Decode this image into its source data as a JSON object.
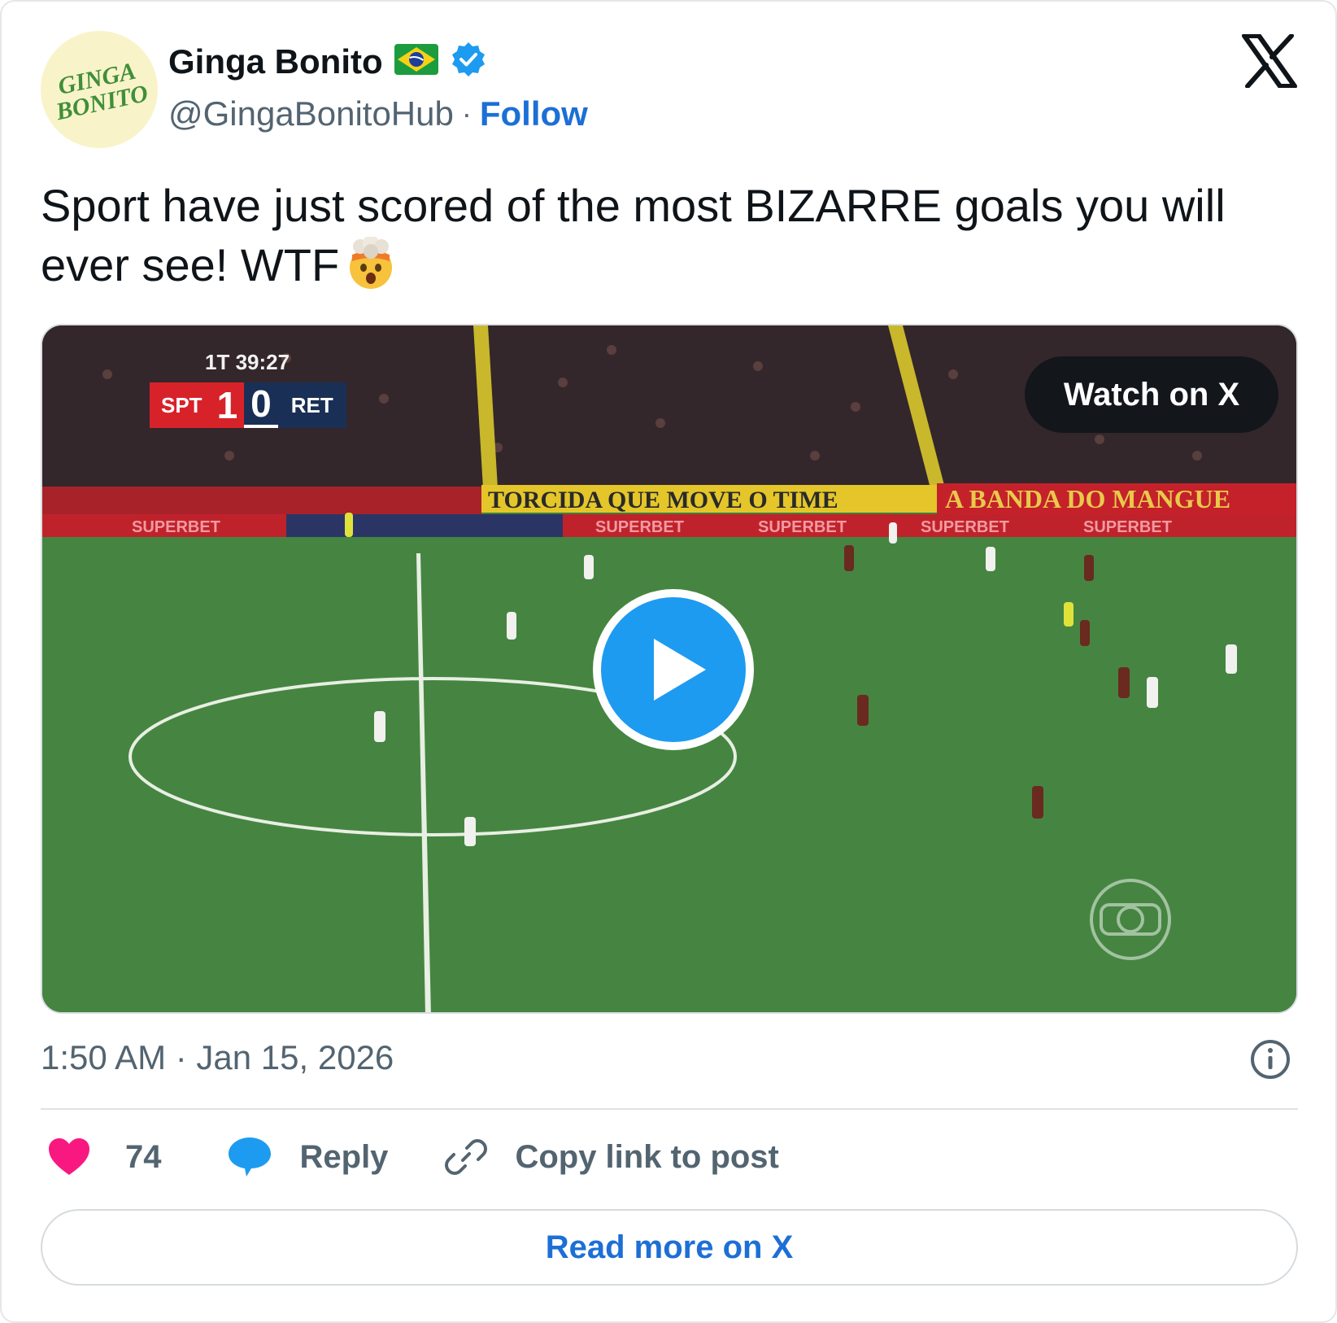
{
  "author": {
    "name": "Ginga Bonito",
    "handle": "@GingaBonitoHub",
    "separator": "·",
    "follow_label": "Follow",
    "avatar_text_line1": "GINGA",
    "avatar_text_line2": "BONITO",
    "avatar_icon": "ginga-bonito-logo",
    "flag_icon": "brazil-flag-icon",
    "verified_icon": "verified-badge-icon"
  },
  "platform_icon": "x-logo-icon",
  "tweet": {
    "text": "Sport have just scored of the most BIZARRE goals you will ever see! WTF",
    "emoji_icon": "exploding-head-emoji-icon"
  },
  "media": {
    "watch_label": "Watch on X",
    "play_icon": "play-icon",
    "scoreboard": {
      "clock": "1T 39:27",
      "home_team": "SPT",
      "home_score": "1",
      "away_score": "0",
      "away_team": "RET"
    },
    "banner_text": "TORCIDA QUE MOVE O TIME",
    "banner_text_2": "A BANDA DO MANGUE",
    "sponsor_text": "SUPERBET",
    "broadcaster_icon": "globo-logo-icon"
  },
  "footer": {
    "timestamp": "1:50 AM · Jan 15, 2026",
    "info_icon": "info-icon",
    "likes": "74",
    "like_icon": "heart-icon",
    "reply_label": "Reply",
    "reply_icon": "reply-bubble-icon",
    "copy_label": "Copy link to post",
    "copy_icon": "link-icon",
    "read_more_label": "Read more on X"
  },
  "colors": {
    "accent": "#1d6fd6",
    "play": "#1d9bf0",
    "like": "#f91880",
    "muted": "#536471",
    "pitch": "#3f7d3d"
  }
}
